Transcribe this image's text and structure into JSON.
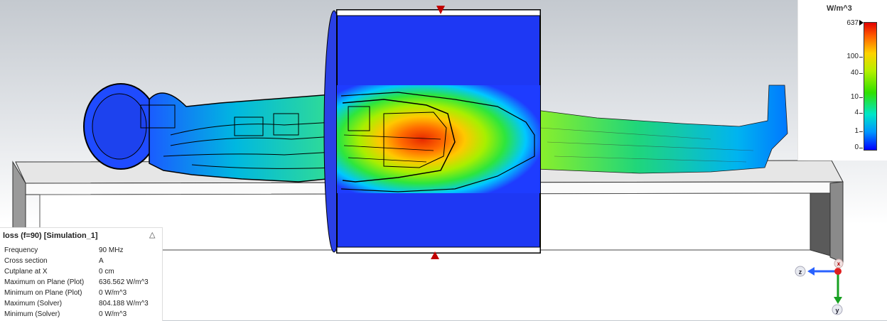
{
  "legend": {
    "unit": "W/m^3",
    "ticks": [
      {
        "label": "637",
        "value": 637
      },
      {
        "label": "100",
        "value": 100
      },
      {
        "label": "40",
        "value": 40
      },
      {
        "label": "10",
        "value": 10
      },
      {
        "label": "4",
        "value": 4
      },
      {
        "label": "1",
        "value": 1
      },
      {
        "label": "0",
        "value": 0
      }
    ],
    "colors": [
      "#0000ff",
      "#0096ff",
      "#00e6c8",
      "#30e000",
      "#b4f000",
      "#ffd200",
      "#ff5a00",
      "#e10000"
    ]
  },
  "info": {
    "title": "loss (f=90) [Simulation_1]",
    "rows": [
      {
        "key": "Frequency",
        "value": "90 MHz"
      },
      {
        "key": "Cross section",
        "value": "A"
      },
      {
        "key": "Cutplane at X",
        "value": "0 cm"
      },
      {
        "key": "Maximum on Plane (Plot)",
        "value": "636.562 W/m^3"
      },
      {
        "key": "Minimum on Plane (Plot)",
        "value": "0 W/m^3"
      },
      {
        "key": "Maximum (Solver)",
        "value": "804.188 W/m^3"
      },
      {
        "key": "Minimum (Solver)",
        "value": "0 W/m^3"
      }
    ]
  },
  "axes": {
    "z_label": "z",
    "y_label": "y",
    "x_label": "x"
  }
}
